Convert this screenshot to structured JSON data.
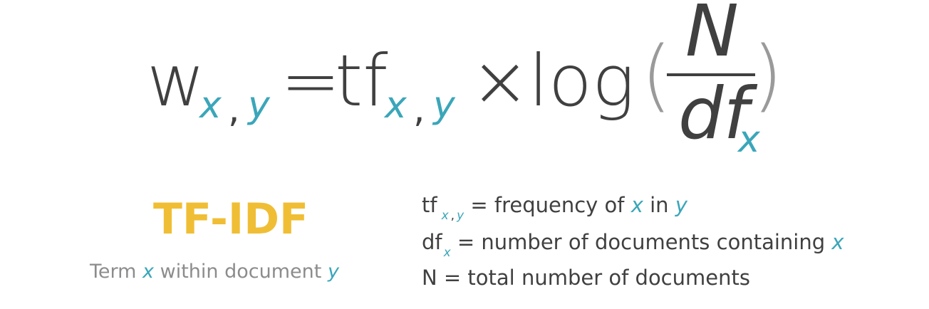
{
  "formula": {
    "w": "w",
    "sub_x": "x",
    "sub_comma": ",",
    "sub_y": "y",
    "equals": "=",
    "tf": "tf",
    "times": "×",
    "log": "log",
    "paren_open": "(",
    "paren_close": ")",
    "numerator": "N",
    "denominator": "df",
    "denominator_sub": "x"
  },
  "title": {
    "text": "TF-IDF",
    "caption_prefix": "Term",
    "caption_var_x": "x",
    "caption_middle": "within document",
    "caption_var_y": "y"
  },
  "legend": {
    "line1": {
      "term": "tf",
      "sub_x": "x",
      "sub_comma": ",",
      "sub_y": "y",
      "text": "= frequency of",
      "var_x": "x",
      "text2": "in",
      "var_y": "y"
    },
    "line2": {
      "term": "df",
      "sub_x": "x",
      "text": "= number of documents containing",
      "var_x": "x"
    },
    "line3": {
      "text": "N = total number of documents"
    }
  },
  "colors": {
    "main_text": "#404040",
    "variable": "#3ba6b9",
    "title": "#f0be35",
    "caption": "#8c8c8c",
    "parenthesis": "#9a9a9a"
  }
}
